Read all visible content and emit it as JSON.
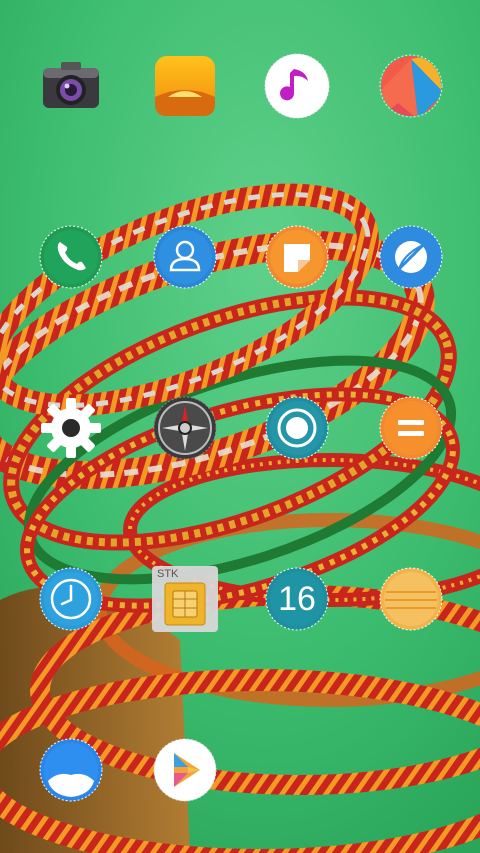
{
  "apps": [
    {
      "id": "camera",
      "name": "camera-app-icon"
    },
    {
      "id": "gallery",
      "name": "gallery-app-icon"
    },
    {
      "id": "music",
      "name": "music-app-icon"
    },
    {
      "id": "themes",
      "name": "themes-app-icon"
    },
    {
      "id": "phone",
      "name": "phone-app-icon"
    },
    {
      "id": "contacts",
      "name": "contacts-app-icon"
    },
    {
      "id": "notes",
      "name": "notes-app-icon"
    },
    {
      "id": "browser",
      "name": "browser-app-icon"
    },
    {
      "id": "settings",
      "name": "settings-app-icon"
    },
    {
      "id": "compass",
      "name": "compass-app-icon"
    },
    {
      "id": "record",
      "name": "recorder-app-icon"
    },
    {
      "id": "calculator",
      "name": "calculator-app-icon"
    },
    {
      "id": "clock",
      "name": "clock-app-icon"
    },
    {
      "id": "sim-toolkit",
      "name": "sim-toolkit-app-icon",
      "chip_label": "STK"
    },
    {
      "id": "calendar",
      "name": "calendar-app-icon",
      "day": "16"
    },
    {
      "id": "memo",
      "name": "memo-app-icon"
    },
    {
      "id": "weather",
      "name": "weather-app-icon"
    },
    {
      "id": "play-store",
      "name": "play-store-app-icon"
    }
  ],
  "colors": {
    "wallpaper_green": "#3fbf73",
    "bangle_red": "#c8261c",
    "bangle_orange": "#ef8a1e",
    "bangle_gold": "#d4a020",
    "icon_teal": "#1f8fa0",
    "icon_blue": "#2a86d8",
    "icon_orange": "#f2892e"
  }
}
